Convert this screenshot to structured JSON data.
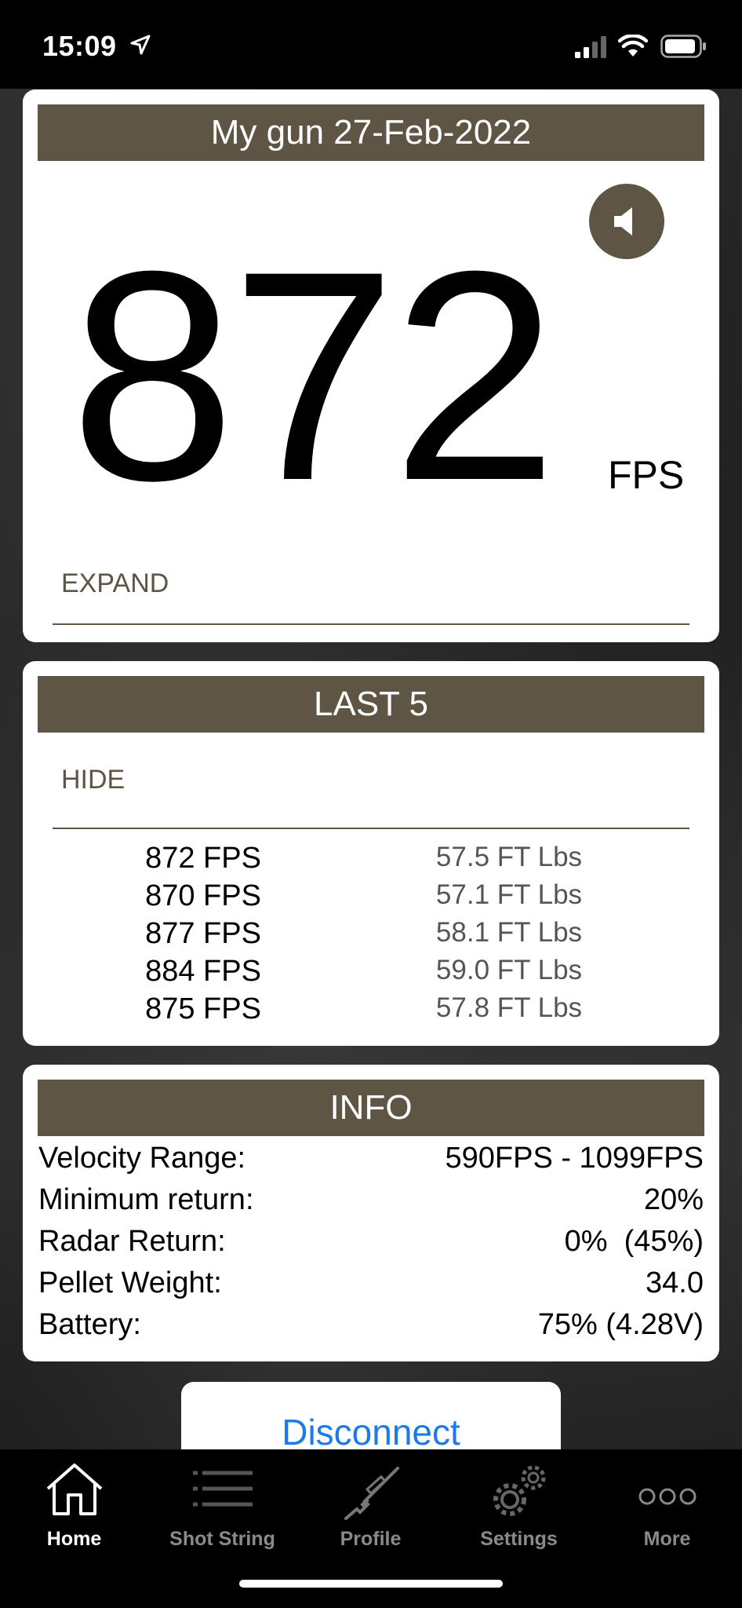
{
  "status_bar": {
    "time": "15:09"
  },
  "card_main": {
    "title": "My gun 27-Feb-2022",
    "velocity": "872",
    "unit": "FPS",
    "expand_label": "EXPAND"
  },
  "card_last": {
    "title": "LAST 5",
    "hide_label": "HIDE",
    "shots": [
      {
        "fps": "872 FPS",
        "energy": "57.5 FT Lbs"
      },
      {
        "fps": "870 FPS",
        "energy": "57.1 FT Lbs"
      },
      {
        "fps": "877 FPS",
        "energy": "58.1 FT Lbs"
      },
      {
        "fps": "884 FPS",
        "energy": "59.0 FT Lbs"
      },
      {
        "fps": "875 FPS",
        "energy": "57.8 FT Lbs"
      }
    ]
  },
  "card_info": {
    "title": "INFO",
    "rows": [
      {
        "label": "Velocity Range:",
        "value": "590FPS - 1099FPS"
      },
      {
        "label": "Minimum return:",
        "value": "20%"
      },
      {
        "label": "Radar Return:",
        "value": "0%  (45%)"
      },
      {
        "label": "Pellet Weight:",
        "value": "34.0"
      },
      {
        "label": "Battery:",
        "value": "75% (4.28V)"
      }
    ]
  },
  "disconnect_label": "Disconnect",
  "tabs": [
    {
      "label": "Home",
      "icon": "home-icon",
      "active": true
    },
    {
      "label": "Shot String",
      "icon": "list-icon",
      "active": false
    },
    {
      "label": "Profile",
      "icon": "rifle-icon",
      "active": false
    },
    {
      "label": "Settings",
      "icon": "gears-icon",
      "active": false
    },
    {
      "label": "More",
      "icon": "more-icon",
      "active": false
    }
  ],
  "colors": {
    "accent": "#5e5544",
    "link": "#1e7ae6"
  }
}
